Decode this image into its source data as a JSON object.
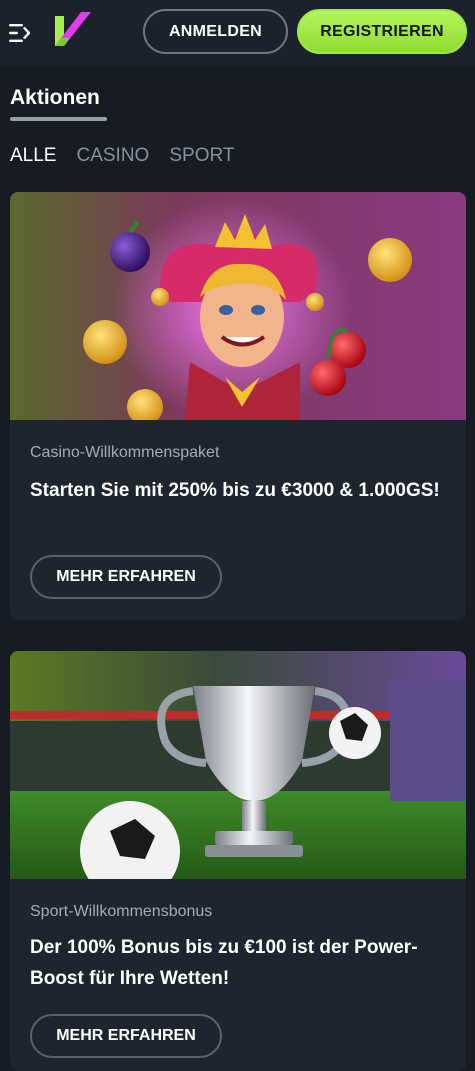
{
  "header": {
    "menu_icon": "collapse-menu-icon",
    "logo_icon": "brand-logo-icon",
    "login_label": "ANMELDEN",
    "register_label": "REGISTRIEREN",
    "colors": {
      "accent": "#a6ee4f",
      "background": "#1c222c"
    }
  },
  "page": {
    "title": "Aktionen"
  },
  "filters": [
    {
      "label": "ALLE",
      "active": true
    },
    {
      "label": "CASINO",
      "active": false
    },
    {
      "label": "SPORT",
      "active": false
    }
  ],
  "promotions": [
    {
      "banner_image": "joker-casino-banner",
      "subtitle": "Casino-Willkommenspaket",
      "headline": "Starten Sie mit 250% bis zu €3000 & 1.000GS!",
      "button_label": "MEHR ERFAHREN"
    },
    {
      "banner_image": "football-trophy-banner",
      "subtitle": "Sport-Willkommensbonus",
      "headline": "Der 100% Bonus bis zu €100 ist der Power-Boost für Ihre Wetten!",
      "button_label": "MEHR ERFAHREN"
    }
  ]
}
